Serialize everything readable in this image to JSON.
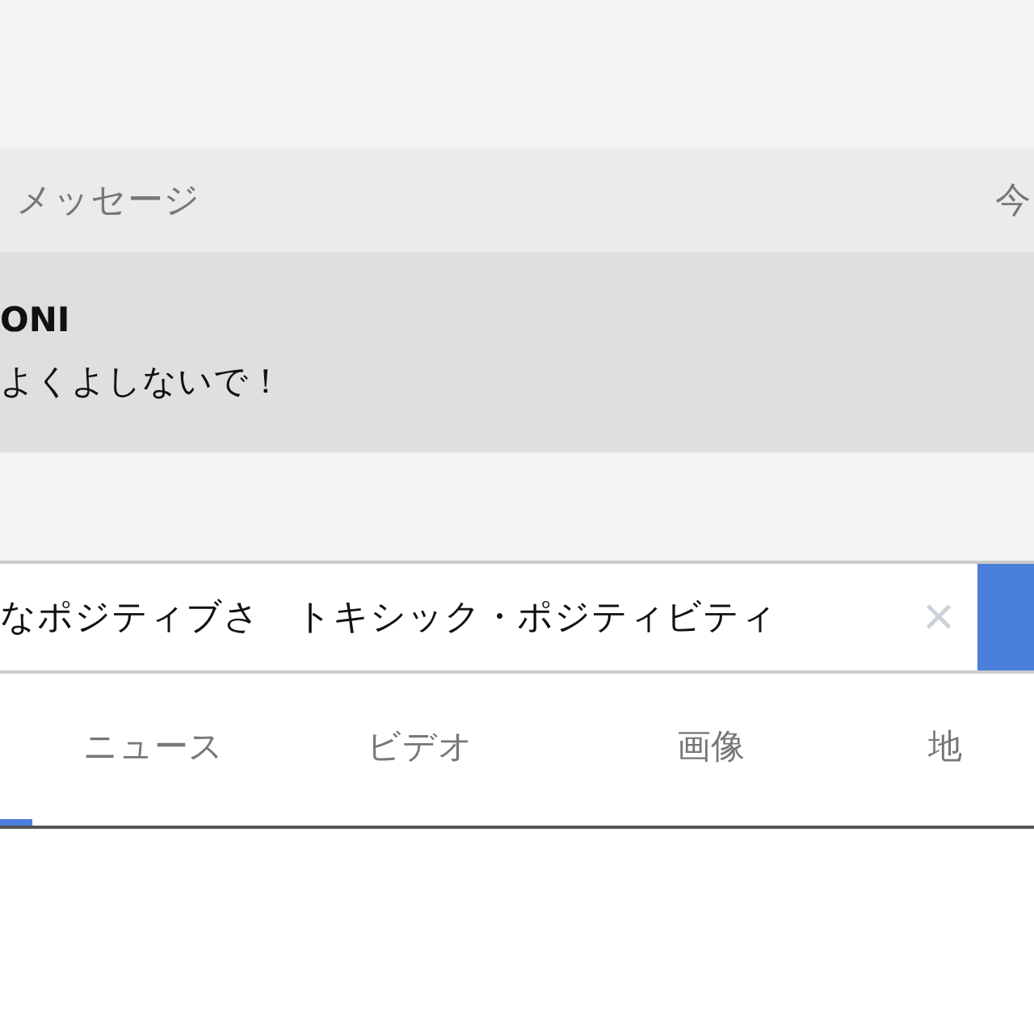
{
  "notification": {
    "app_name": "メッセージ",
    "time": "今",
    "sender": "ONI",
    "message": "よくよしないで！"
  },
  "search": {
    "value": "なポジティブさ　トキシック・ポジティビティ",
    "clear": "×"
  },
  "tabs": [
    {
      "selected": true
    },
    {
      "label": "ニュース",
      "selected": false
    },
    {
      "label": "ビデオ",
      "selected": false
    },
    {
      "label": "画像",
      "selected": false
    },
    {
      "label": "地",
      "selected": false
    }
  ]
}
